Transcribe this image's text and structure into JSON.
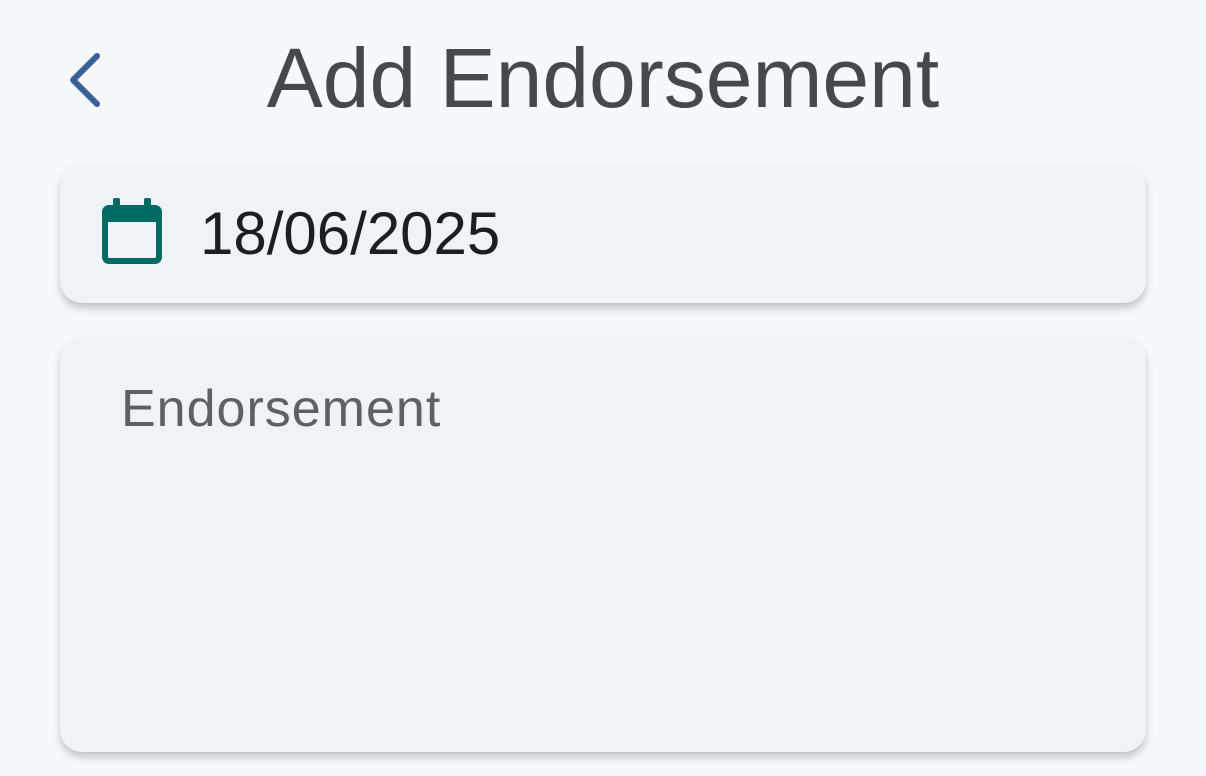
{
  "header": {
    "title": "Add Endorsement",
    "back_icon": "chevron-left-icon",
    "back_color": "#3b6196"
  },
  "date_field": {
    "icon": "calendar-icon",
    "icon_color": "#006b62",
    "value": "18/06/2025"
  },
  "endorsement_field": {
    "placeholder": "Endorsement",
    "value": ""
  }
}
